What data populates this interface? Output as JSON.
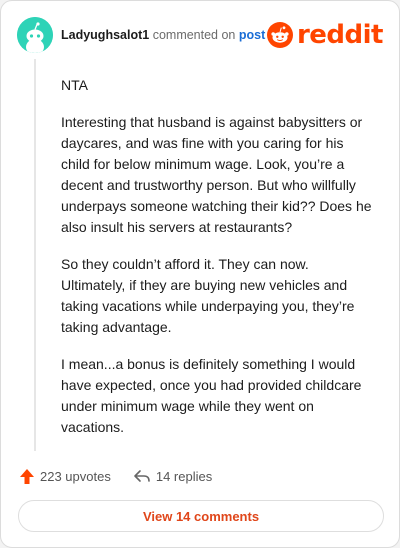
{
  "comment": {
    "username": "Ladyughsalot1",
    "action_text": "commented on",
    "post_link": "post",
    "paragraphs": [
      "NTA",
      "Interesting that husband is against babysitters or daycares, and was fine with you caring for his child for below minimum wage. Look, you’re a decent and trustworthy person. But who willfully underpays someone watching their kid?? Does he also insult his servers at restaurants?",
      "So they couldn’t afford it. They can now. Ultimately, if they are buying new vehicles and taking vacations while underpaying you, they’re taking advantage.",
      "I mean...a bonus is definitely something I would have expected, once you had provided childcare under minimum wage while they went on vacations."
    ]
  },
  "brand": {
    "wordmark": "reddit",
    "color": "#ff4500"
  },
  "actions": {
    "upvotes": "223 upvotes",
    "replies": "14 replies"
  },
  "footer": {
    "view_comments": "View 14 comments"
  },
  "icons": {
    "avatar": "snoo-avatar-icon",
    "logo": "reddit-snoo-icon",
    "upvote": "upvote-arrow-icon",
    "reply": "reply-arrow-icon"
  }
}
